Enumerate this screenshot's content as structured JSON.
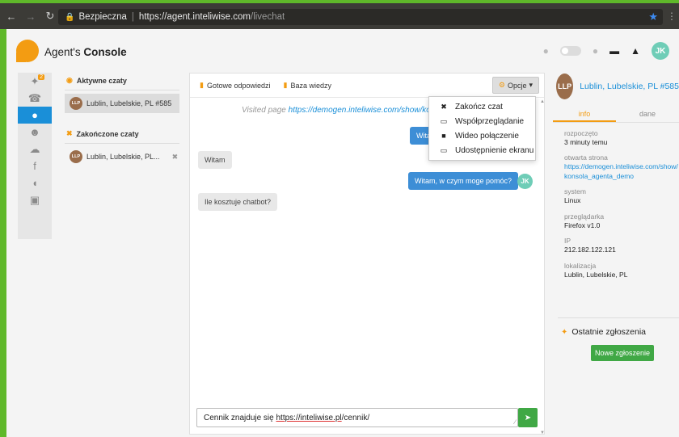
{
  "browser": {
    "secure_label": "Bezpieczna",
    "url_host": "https://agent.inteliwise.com",
    "url_path": "/livechat"
  },
  "header": {
    "brand_prefix": "Agent's",
    "brand_bold": "Console",
    "user_initials": "JK"
  },
  "iconbar": {
    "badge_count": "2"
  },
  "chatlist": {
    "active_heading": "Aktywne czaty",
    "active_items": [
      {
        "initials": "LLP",
        "label": "Lublin, Lubelskie, PL #585"
      }
    ],
    "closed_heading": "Zakończone czaty",
    "closed_items": [
      {
        "initials": "LLP",
        "label": "Lublin, Lubelskie, PL..."
      }
    ]
  },
  "chat": {
    "toolbar": {
      "canned_responses": "Gotowe odpowiedzi",
      "knowledge_base": "Baza wiedzy",
      "options": "Opcje"
    },
    "visited_prefix": "Visited page",
    "visited_url": "https://demogen.inteliwise.com/show/konsol",
    "messages": [
      {
        "from": "agent",
        "text": "Witaj"
      },
      {
        "from": "client",
        "text": "Witam"
      },
      {
        "from": "agent",
        "text": "Witam, w czym moge pomóc?"
      },
      {
        "from": "client",
        "text": "Ile kosztuje chatbot?"
      }
    ],
    "compose_prefix": "Cennik znajduje się ",
    "compose_link": "https://inteliwise.pl",
    "compose_suffix": "/cennik/"
  },
  "dropdown": {
    "items": [
      {
        "icon": "close-icon",
        "label": "Zakończ czat"
      },
      {
        "icon": "monitor-icon",
        "label": "Współprzeglądanie"
      },
      {
        "icon": "video-camera-icon",
        "label": "Wideo połączenie"
      },
      {
        "icon": "desktop-icon",
        "label": "Udostępnienie ekranu"
      }
    ]
  },
  "info": {
    "initials": "LLP",
    "name": "Lublin, Lubelskie, PL #585",
    "tabs": [
      "info",
      "dane"
    ],
    "fields": [
      {
        "label": "rozpoczęto",
        "value": "3 minuty temu"
      },
      {
        "label": "otwarta strona",
        "value": "https://demogen.inteliwise.com/show/konsola_agenta_demo"
      },
      {
        "label": "system",
        "value": "Linux"
      },
      {
        "label": "przeglądarka",
        "value": "Firefox v1.0"
      },
      {
        "label": "IP",
        "value": "212.182.122.121"
      },
      {
        "label": "lokalizacja",
        "value": "Lublin, Lubelskie, PL"
      }
    ],
    "tickets_heading": "Ostatnie zgłoszenia",
    "new_ticket": "Nowe zgłoszenie"
  },
  "colors": {
    "primary_blue": "#1a8fd8",
    "accent_orange": "#f39c12",
    "success_green": "#40a845",
    "frame_green": "#5fb82a"
  }
}
